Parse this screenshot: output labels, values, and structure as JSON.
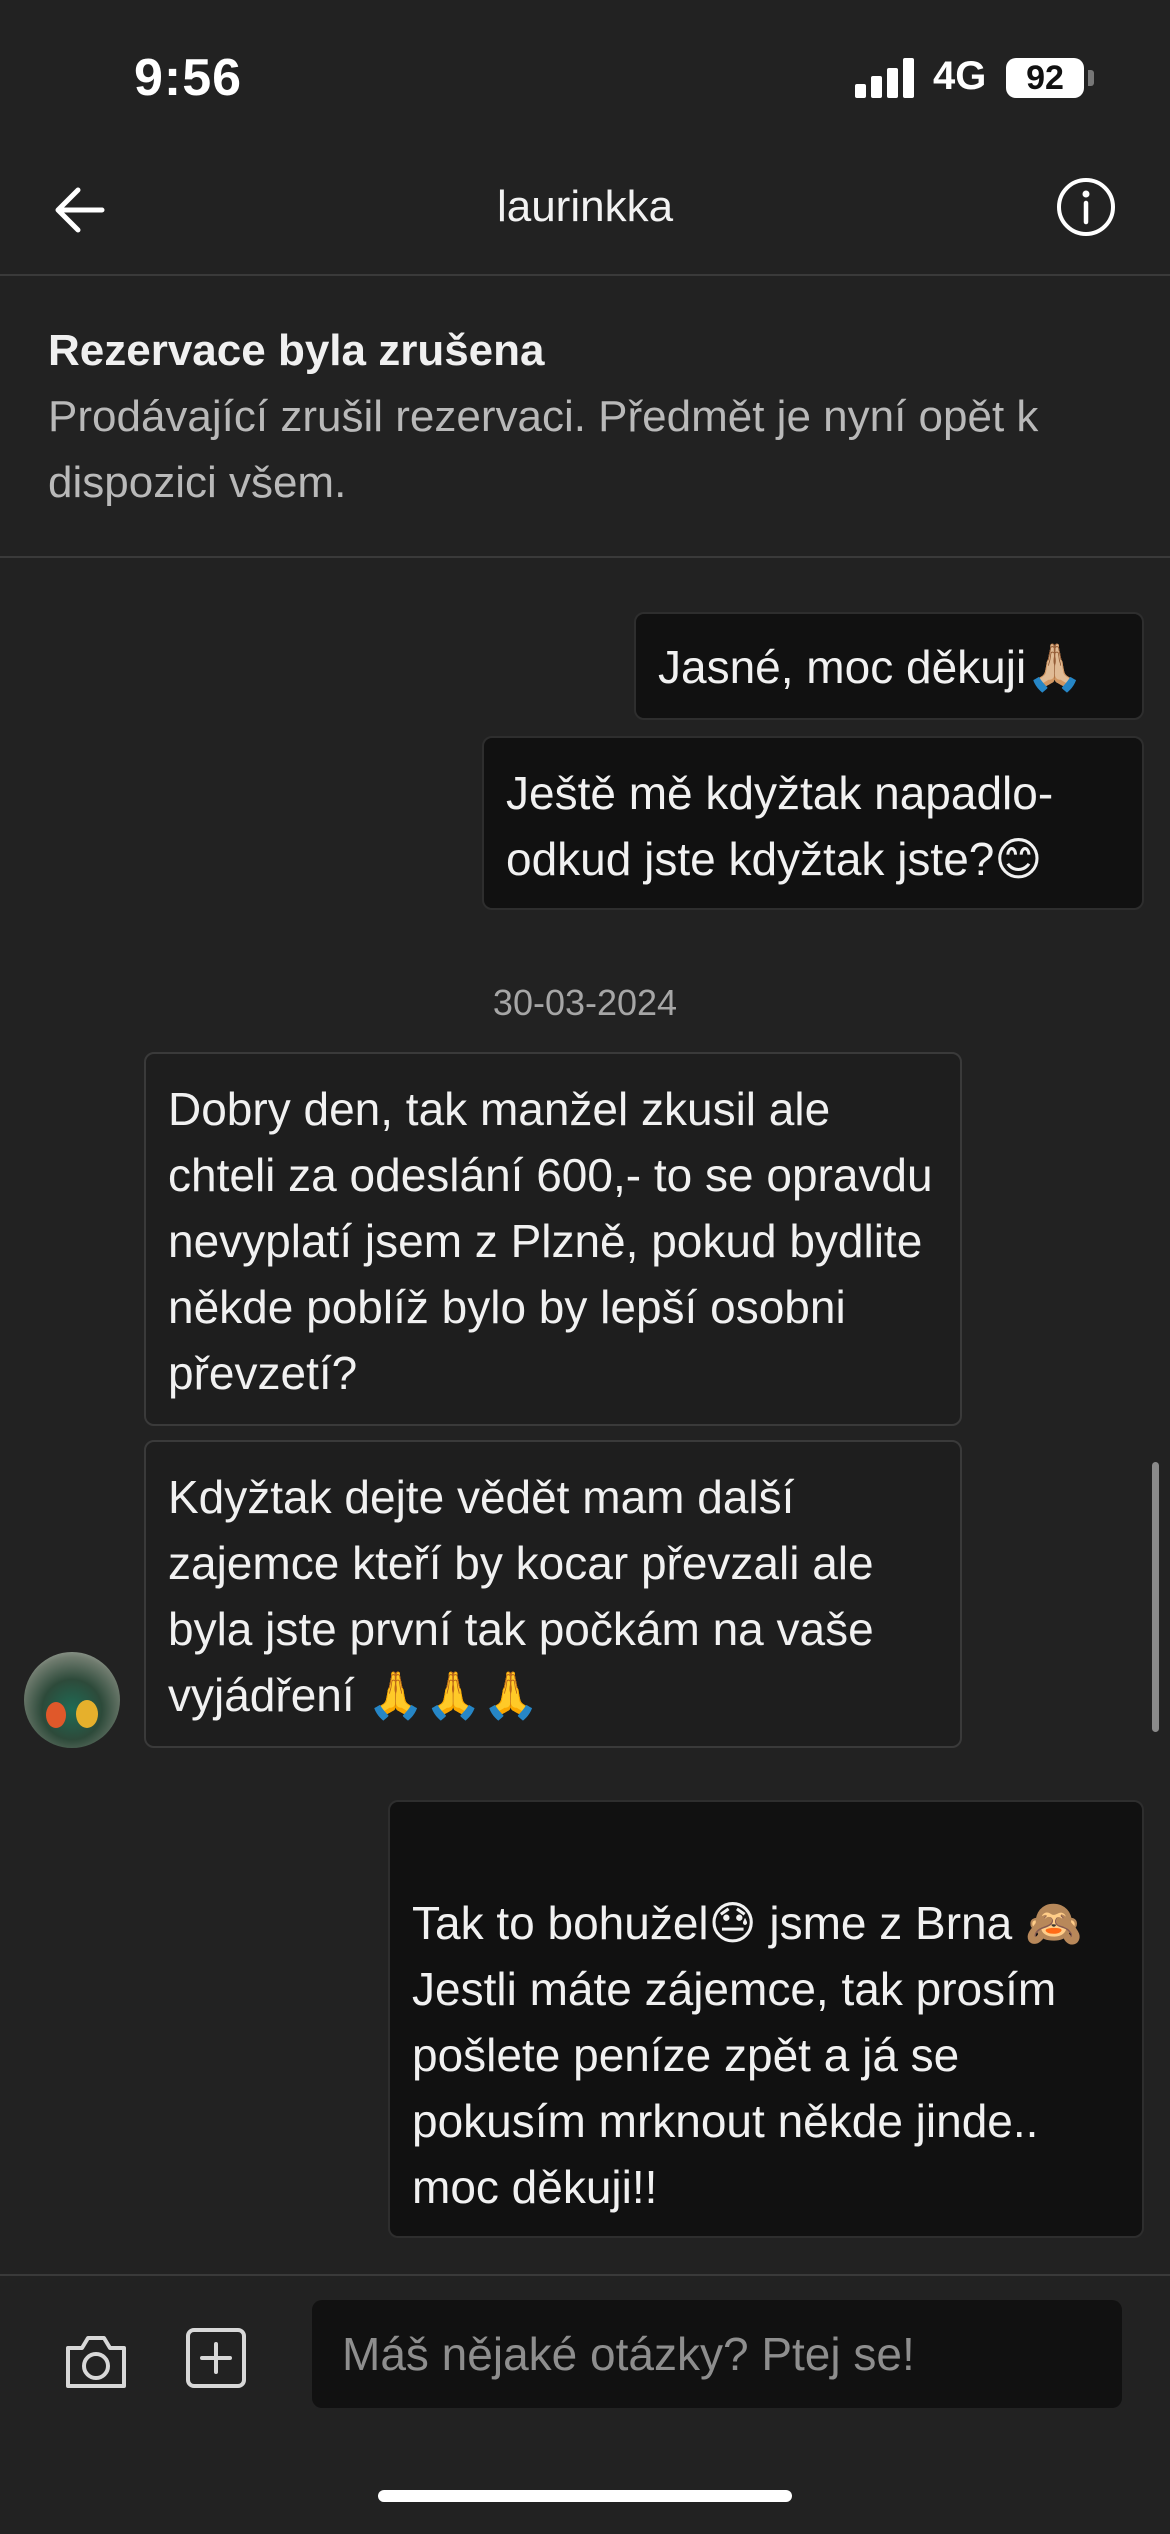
{
  "status_bar": {
    "time": "9:56",
    "network": "4G",
    "battery": "92"
  },
  "header": {
    "title": "laurinkka"
  },
  "banner": {
    "title": "Rezervace byla zrušena",
    "text": "Prodávající zrušil rezervaci. Předmět je nyní opět k dispozici všem."
  },
  "messages": [
    {
      "direction": "out",
      "text": "Jasné, moc děkuji🙏🏼"
    },
    {
      "direction": "out",
      "text": "Ještě mě kdyžtak napadlo- odkud jste kdyžtak jste?😊"
    },
    {
      "direction": "in",
      "text": "Dobry den, tak manžel zkusil ale chteli za odeslání 600,- to se opravdu nevyplatí jsem z Plzně, pokud bydlite někde poblíž bylo by lepší osobni převzetí?"
    },
    {
      "direction": "in",
      "text": "Kdyžtak dejte vědět mam další zajemce kteří by kocar převzali ale byla jste první tak počkám na vaše vyjádření 🙏🙏🙏"
    },
    {
      "direction": "out",
      "text": "Tak to bohužel😓 jsme z Brna 🙈\nJestli máte zájemce, tak prosím pošlete peníze zpět a já se pokusím mrknout někde jinde.. moc děkuji!!"
    }
  ],
  "date_separator": "30-03-2024",
  "composer": {
    "placeholder": "Máš nějaké otázky? Ptej se!"
  },
  "icons": {
    "back": "arrow-left-icon",
    "info": "info-icon",
    "camera": "camera-icon",
    "add": "plus-square-icon"
  }
}
